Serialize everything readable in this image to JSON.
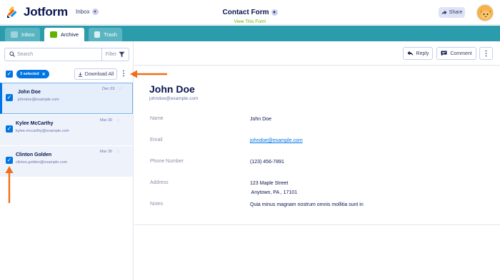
{
  "topbar": {
    "brand": "Jotform",
    "inbox_label": "Inbox",
    "form_title": "Contact Form",
    "view_form": "View This Form",
    "share_label": "Share"
  },
  "tabs": [
    {
      "label": "Inbox"
    },
    {
      "label": "Archive"
    },
    {
      "label": "Trash"
    }
  ],
  "left": {
    "search_placeholder": "Search",
    "filter_label": "Filter",
    "selected_label": "3 selected",
    "download_label": "Download All",
    "submissions": [
      {
        "name": "John Doe",
        "email": "johndoe@example.com",
        "date": "Dec 03"
      },
      {
        "name": "Kylee McCarthy",
        "email": "kylee.mccarthy@example.com",
        "date": "Mar 30"
      },
      {
        "name": "Clinton Golden",
        "email": "clinton.golden@example.com",
        "date": "Mar 30"
      }
    ]
  },
  "right": {
    "reply_label": "Reply",
    "comment_label": "Comment",
    "submitter_name": "John Doe",
    "submitter_email": "johndoe@example.com",
    "fields": [
      {
        "label": "Name",
        "value": "John Doe"
      },
      {
        "label": "Email",
        "value": "johndoe@example.com"
      },
      {
        "label": "Phone Number",
        "value": "(123) 456-7891"
      },
      {
        "label": "Address",
        "value_line1": "123 Maple Street",
        "value_line2": " Anytown, PA , 17101"
      },
      {
        "label": "Notes",
        "value": "Quia minus magnam nostrum omnis mollitia sunt in"
      }
    ]
  },
  "colors": {
    "tabbar": "#2b9cac",
    "accent_blue": "#0075e3",
    "annotation_arrow": "#f06f1a"
  }
}
